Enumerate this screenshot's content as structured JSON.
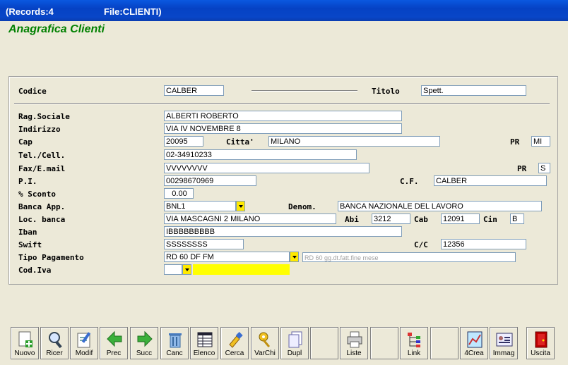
{
  "titlebar": {
    "records": "(Records:4",
    "file": "File:CLIENTI)"
  },
  "app": {
    "title": "Anagrafica Clienti"
  },
  "form": {
    "codice": {
      "label": "Codice",
      "value": "CALBER"
    },
    "titolo": {
      "label": "Titolo",
      "value": "Spett."
    },
    "rag_sociale": {
      "label": "Rag.Sociale",
      "value": "ALBERTI ROBERTO"
    },
    "indirizzo": {
      "label": "Indirizzo",
      "value": "VIA IV NOVEMBRE 8"
    },
    "cap": {
      "label": "Cap",
      "value": "20095"
    },
    "citta": {
      "label": "Citta'",
      "value": "MILANO"
    },
    "pr1": {
      "label": "PR",
      "value": "MI"
    },
    "tel": {
      "label": "Tel./Cell.",
      "value": "02-34910233"
    },
    "fax": {
      "label": "Fax/E.mail",
      "value": "VVVVVVVV"
    },
    "pr2": {
      "label": "PR",
      "value": "S"
    },
    "pi": {
      "label": "P.I.",
      "value": "00298670969"
    },
    "cf": {
      "label": "C.F.",
      "value": "CALBER"
    },
    "sconto": {
      "label": "% Sconto",
      "value": "0.00"
    },
    "banca": {
      "label": "Banca App.",
      "value": "BNL1"
    },
    "denom": {
      "label": "Denom.",
      "value": "BANCA NAZIONALE DEL LAVORO"
    },
    "loc_banca": {
      "label": "Loc. banca",
      "value": "VIA MASCAGNI 2  MILANO"
    },
    "abi": {
      "label": "Abi",
      "value": "3212"
    },
    "cab": {
      "label": "Cab",
      "value": "12091"
    },
    "cin": {
      "label": "Cin",
      "value": "B"
    },
    "iban": {
      "label": "Iban",
      "value": "IBBBBBBBBB"
    },
    "swift": {
      "label": "Swift",
      "value": "SSSSSSSS"
    },
    "cc": {
      "label": "C/C",
      "value": "12356"
    },
    "tipo_pagamento": {
      "label": "Tipo Pagamento",
      "value": "RD 60 DF FM",
      "desc": "RD 60 gg.dt.fatt.fine mese"
    },
    "cod_iva": {
      "label": "Cod.Iva",
      "value": "",
      "desc": ""
    }
  },
  "toolbar": {
    "nuovo": "Nuovo",
    "ricer": "Ricer",
    "modif": "Modif",
    "prec": "Prec",
    "succ": "Succ",
    "canc": "Canc",
    "elenco": "Elenco",
    "cerca": "Cerca",
    "varchi": "VarChi",
    "dupl": "Dupl",
    "liste": "Liste",
    "link": "Link",
    "crea": "4Crea",
    "immag": "Immag",
    "uscita": "Uscita"
  },
  "colors": {
    "accent": "#008000",
    "titlebar": "#0542c4",
    "highlight": "#ffff00"
  }
}
